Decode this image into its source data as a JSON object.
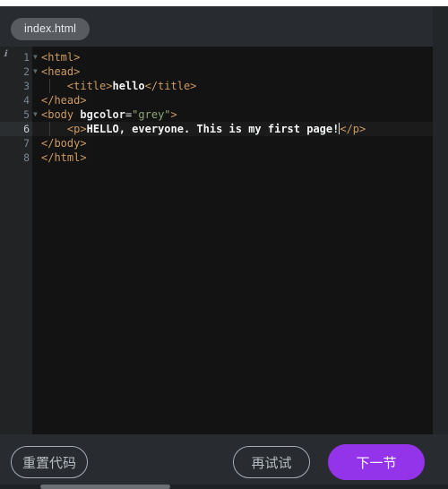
{
  "editor": {
    "tab_label": "index.html",
    "hint_icon": "info-icon",
    "active_line": 6,
    "lines": [
      {
        "num": "1",
        "foldable": true,
        "indent_guides": 0
      },
      {
        "num": "2",
        "foldable": true,
        "indent_guides": 0
      },
      {
        "num": "3",
        "foldable": false,
        "indent_guides": 1
      },
      {
        "num": "4",
        "foldable": false,
        "indent_guides": 0
      },
      {
        "num": "5",
        "foldable": true,
        "indent_guides": 0
      },
      {
        "num": "6",
        "foldable": false,
        "indent_guides": 1
      },
      {
        "num": "7",
        "foldable": false,
        "indent_guides": 0
      },
      {
        "num": "8",
        "foldable": false,
        "indent_guides": 0
      }
    ],
    "code": {
      "l1_tag": "<html>",
      "l2_tag": "<head>",
      "l3_open": "<title>",
      "l3_text": "hello",
      "l3_close": "</title>",
      "l4_tag": "</head>",
      "l5_open": "<body ",
      "l5_attr": "bgcolor",
      "l5_eq": "=",
      "l5_value": "\"grey\"",
      "l5_gt": ">",
      "l6_open": "<p>",
      "l6_text": "HELLO, everyone. This is my first page!",
      "l6_close": "</p>",
      "l7_tag": "</body>",
      "l8_tag": "</html>"
    }
  },
  "bottom": {
    "reset_label": "重置代码",
    "retry_label": "再试试",
    "next_label": "下一节"
  },
  "colors": {
    "accent": "#9333ea",
    "editor_bg": "#131313",
    "panel_bg": "#282c30",
    "gutter_bg": "#212325",
    "tag": "#cc9a63",
    "string": "#8fa876",
    "text": "#f2f4f6"
  }
}
